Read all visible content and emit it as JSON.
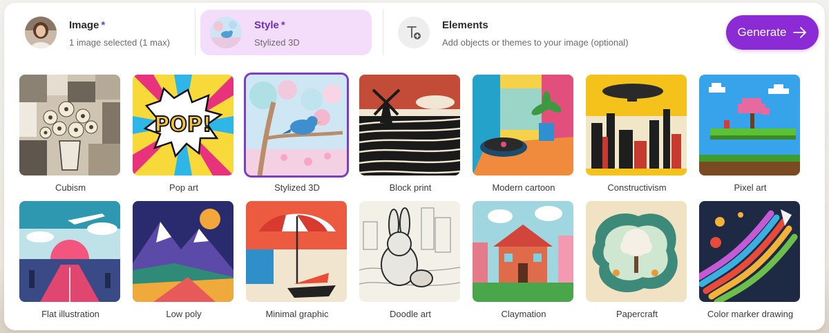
{
  "header": {
    "image": {
      "title": "Image",
      "required_mark": "*",
      "subtitle": "1 image selected (1 max)"
    },
    "style": {
      "title": "Style",
      "required_mark": "*",
      "subtitle": "Stylized 3D"
    },
    "elements": {
      "title": "Elements",
      "subtitle": "Add objects or themes to your image (optional)"
    },
    "generate_label": "Generate"
  },
  "selected_style": "Stylized 3D",
  "accent_color": "#8a2bd6",
  "styles": [
    {
      "label": "Cubism"
    },
    {
      "label": "Pop art"
    },
    {
      "label": "Stylized 3D"
    },
    {
      "label": "Block print"
    },
    {
      "label": "Modern cartoon"
    },
    {
      "label": "Constructivism"
    },
    {
      "label": "Pixel art"
    },
    {
      "label": "Flat illustration"
    },
    {
      "label": "Low poly"
    },
    {
      "label": "Minimal graphic"
    },
    {
      "label": "Doodle art"
    },
    {
      "label": "Claymation"
    },
    {
      "label": "Papercraft"
    },
    {
      "label": "Color marker drawing"
    }
  ]
}
